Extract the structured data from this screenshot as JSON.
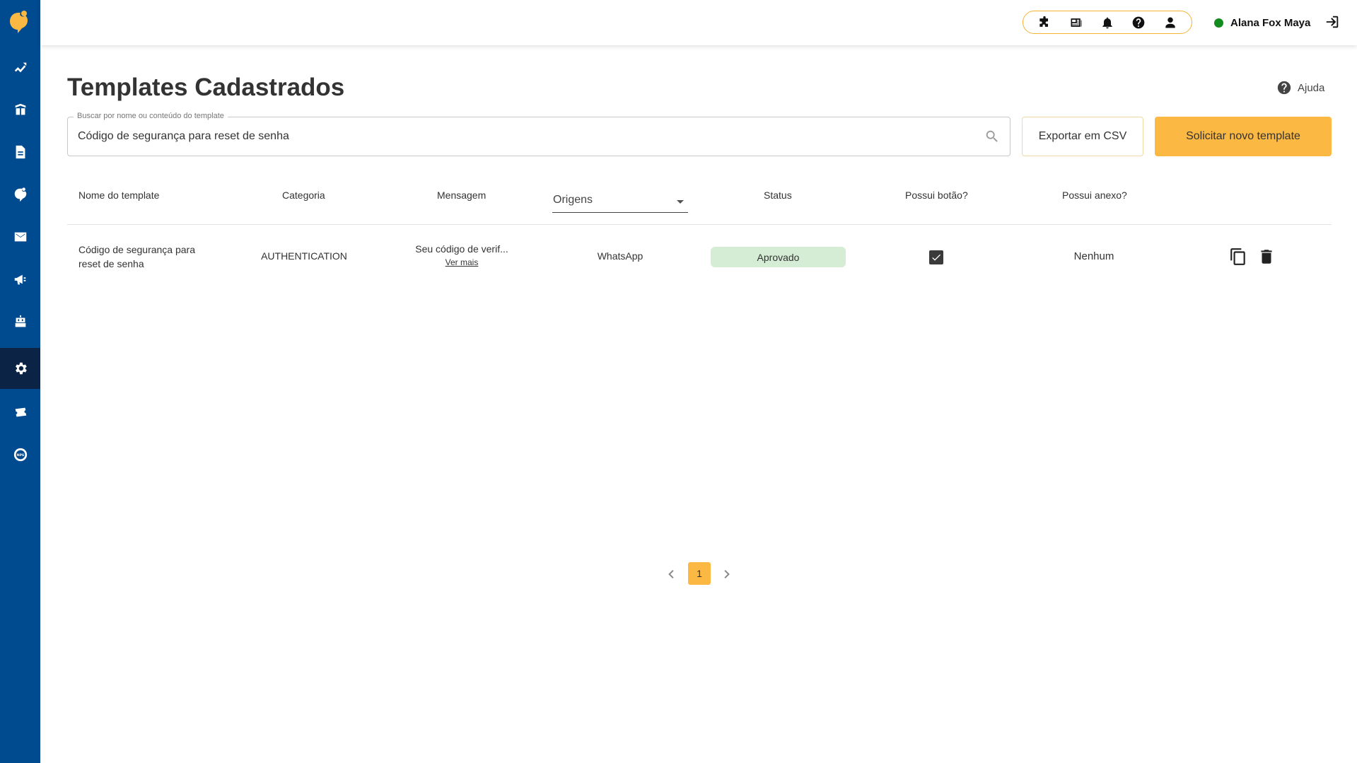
{
  "topbar": {
    "tools": [
      {
        "icon": "puzzle-icon"
      },
      {
        "icon": "newspaper-icon"
      },
      {
        "icon": "bell-icon"
      },
      {
        "icon": "help-circle-icon"
      },
      {
        "icon": "user-icon"
      }
    ],
    "user_name": "Alana Fox Maya",
    "user_status_color": "#128a1e"
  },
  "sidebar": {
    "items": [
      {
        "icon": "analytics-icon"
      },
      {
        "icon": "buildings-icon"
      },
      {
        "icon": "document-icon"
      },
      {
        "icon": "chat-logo-icon"
      },
      {
        "icon": "mail-icon"
      },
      {
        "icon": "megaphone-icon"
      },
      {
        "icon": "robot-icon"
      },
      {
        "icon": "settings-icon",
        "active": true
      },
      {
        "icon": "ticket-icon"
      },
      {
        "icon": "nps-icon"
      }
    ]
  },
  "page": {
    "title": "Templates Cadastrados",
    "help_label": "Ajuda"
  },
  "search": {
    "legend": "Buscar por nome ou conteúdo do template",
    "value": "Código de segurança para reset de senha"
  },
  "actions": {
    "export_label": "Exportar em CSV",
    "new_label": "Solicitar novo template"
  },
  "table": {
    "headers": {
      "name": "Nome do template",
      "category": "Categoria",
      "message": "Mensagem",
      "origins": "Origens",
      "status": "Status",
      "has_button": "Possui botão?",
      "has_attachment": "Possui anexo?"
    },
    "rows": [
      {
        "name": "Código de segurança para reset de senha",
        "category": "AUTHENTICATION",
        "message": "Seu código de verif...",
        "see_more": "Ver mais",
        "origin": "WhatsApp",
        "status": "Aprovado",
        "has_button": true,
        "attachment": "Nenhum"
      }
    ]
  },
  "pagination": {
    "current": "1"
  },
  "colors": {
    "sidebar": "#004a8f",
    "sidebar_active": "#0b2446",
    "accent": "#fbb843",
    "status_approved_bg": "#d5edd5"
  }
}
